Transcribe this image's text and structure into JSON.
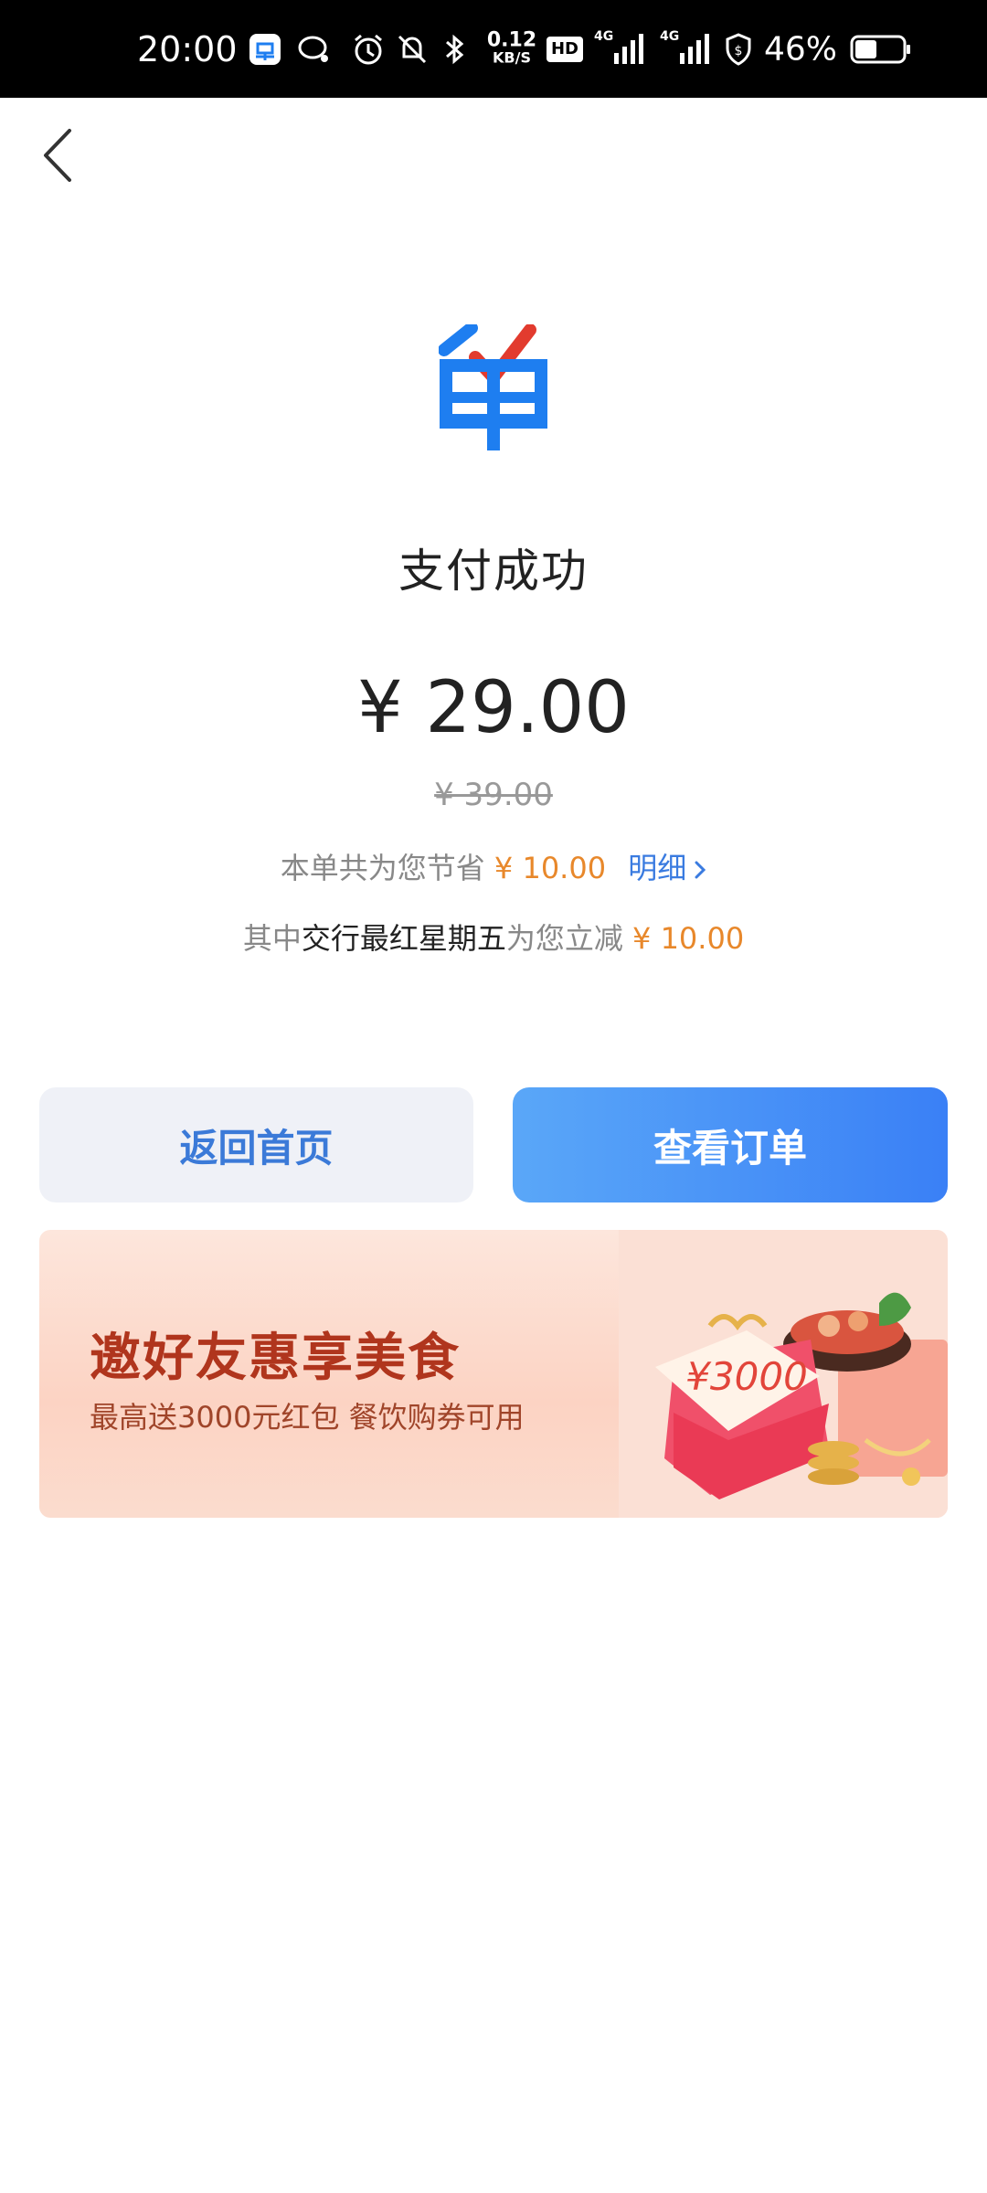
{
  "status_bar": {
    "time": "20:00",
    "net_speed_value": "0.12",
    "net_speed_unit": "KB/S",
    "hd_label": "HD",
    "signal1_label": "4G",
    "signal2_label": "4G",
    "battery_percent": "46%",
    "battery_level": 0.46,
    "icons": [
      "pay-app-icon",
      "chat-icon",
      "alarm-icon",
      "mute-icon",
      "bluetooth-icon",
      "signal-icon",
      "signal-icon",
      "security-shield-icon",
      "battery-icon"
    ]
  },
  "header": {
    "back_icon": "chevron-left-icon"
  },
  "logo": {
    "glyph": "单",
    "primary_color": "#1e7ef0",
    "check_color": "#e23b2e"
  },
  "result": {
    "title": "支付成功",
    "price": "¥ 29.00",
    "original_price": "¥ 39.00",
    "savings_prefix": "本单共为您节省",
    "savings_amount": "¥ 10.00",
    "detail_label": "明细",
    "promo_prefix": "其中",
    "promo_bank": "交行最红星期五",
    "promo_middle": "为您立减",
    "promo_amount": "¥ 10.00"
  },
  "buttons": {
    "home_label": "返回首页",
    "orders_label": "查看订单"
  },
  "banner": {
    "title": "邀好友惠享美食",
    "subtitle": "最高送3000元红包  餐饮购券可用",
    "envelope_text": "¥3000"
  },
  "colors": {
    "accent_blue": "#3a7be0",
    "price_orange": "#e8882b",
    "banner_red": "#b0351d"
  }
}
